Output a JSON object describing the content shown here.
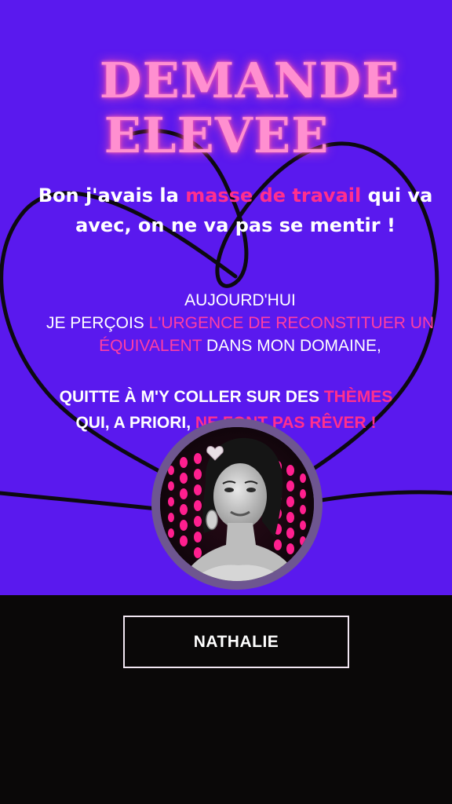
{
  "headline": {
    "line1": "DEMANDE",
    "line2": "ELEVEE"
  },
  "quote": {
    "part1": "Bon j'avais la ",
    "highlight": "masse de travail",
    "part2": " qui va avec, on ne va pas se mentir !"
  },
  "paragraph1": {
    "line1": "AUJOURD'HUI",
    "prefix": "JE PERÇOIS ",
    "highlight": "L'URGENCE DE RECONSTITUER UN ÉQUIVALENT",
    "suffix": " DANS MON DOMAINE,"
  },
  "paragraph2": {
    "prefix": "QUITTE À M'Y COLLER SUR DES ",
    "highlight1": "THÈMES",
    "middle": " QUI, A PRIORI, ",
    "highlight2": "NE FONT PAS RÊVER !"
  },
  "name_button": {
    "label": "NATHALIE"
  },
  "colors": {
    "background_purple": "#5a19ee",
    "accent_pink": "#ff2f8e",
    "title_pink": "#ff8fd0",
    "footer": "#0a0808"
  },
  "icons": {
    "decoration": "heart-outline",
    "avatar": "portrait-photo"
  }
}
